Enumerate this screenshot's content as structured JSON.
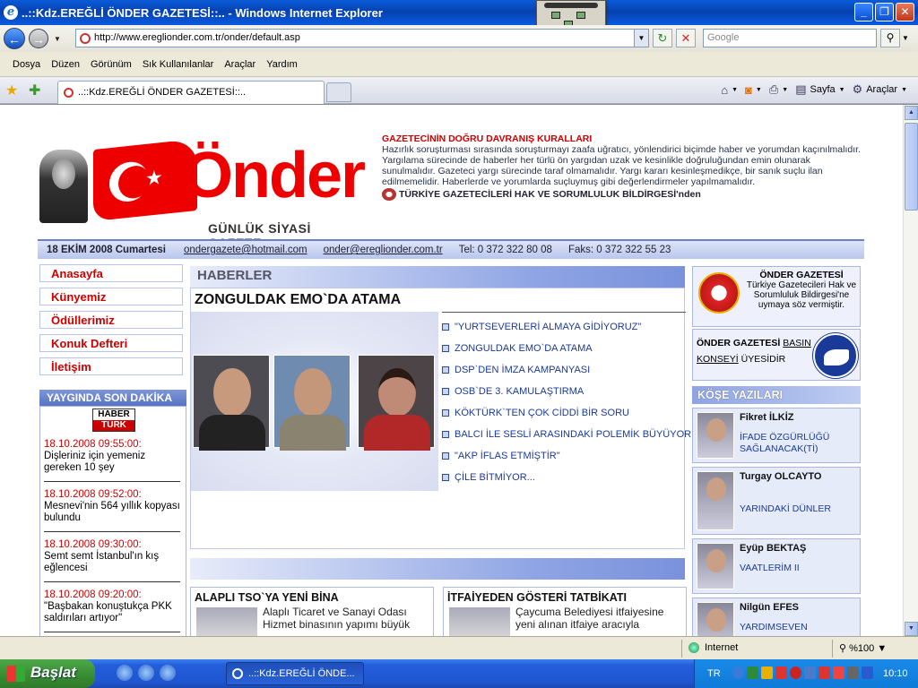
{
  "window": {
    "title": "..::Kdz.EREĞLİ ÖNDER GAZETESİ::.. - Windows Internet Explorer"
  },
  "address": {
    "url": "http://www.ereglionder.com.tr/onder/default.asp",
    "search_placeholder": "Google"
  },
  "menu": [
    "Dosya",
    "Düzen",
    "Görünüm",
    "Sık Kullanılanlar",
    "Araçlar",
    "Yardım"
  ],
  "tab": {
    "title": "..::Kdz.EREĞLİ ÖNDER GAZETESİ::.."
  },
  "commandbar": {
    "page": "Sayfa",
    "tools": "Araçlar"
  },
  "page": {
    "logo": {
      "word": "Önder",
      "subtitle": "GÜNLÜK SİYASİ GAZETE"
    },
    "rules": {
      "title": "GAZETECİNİN DOĞRU DAVRANIŞ KURALLARI",
      "body": "Hazırlık soruşturması sırasında soruşturmayı zaafa uğratıcı, yönlendirici biçimde haber ve yorumdan kaçınılmalıdır. Yargılama sürecinde de haberler her türlü ön yargıdan uzak ve kesinlikle doğruluğundan emin olunarak sunulmalıdır. Gazeteci yargı sürecinde taraf olmamalıdır. Yargı kararı kesinleşmedikçe, bir sanık suçlu ilan edilmemelidir. Haberlerde ve yorumlarda suçluymuş gibi değerlendirmeler yapılmamalıdır.",
      "source": "TÜRKİYE GAZETECİLERİ HAK VE SORUMLULUK BİLDİRGESİ'nden"
    },
    "datebar": {
      "date": "18 EKİM 2008 Cumartesi",
      "email1": "ondergazete@hotmail.com",
      "email2": "onder@ereglionder.com.tr",
      "tel": "Tel: 0 372 322 80 08",
      "fax": "Faks: 0 372 322 55 23"
    },
    "nav": [
      "Anasayfa",
      "Künyemiz",
      "Ödüllerimiz",
      "Konuk Defteri",
      "İletişim"
    ],
    "breaking": {
      "title": "YAYGINDA SON DAKİKA",
      "logo_top": "HABER",
      "logo_bottom": "TÜRK",
      "items": [
        {
          "time": "18.10.2008 09:55:00:",
          "text": "Dişleriniz için yemeniz gereken 10 şey"
        },
        {
          "time": "18.10.2008 09:52:00:",
          "text": "Mesnevi'nin 564 yıllık kopyası bulundu"
        },
        {
          "time": "18.10.2008 09:30:00:",
          "text": "Semt semt İstanbul'ın kış eğlencesi"
        },
        {
          "time": "18.10.2008 09:20:00:",
          "text": "\"Başbakan konuştukça PKK saldırıları artıyor\""
        }
      ]
    },
    "news": {
      "section": "HABERLER",
      "headline": "ZONGULDAK EMO`DA ATAMA",
      "links": [
        "\"YURTSEVERLERİ ALMAYA GİDİYORUZ\"",
        "ZONGULDAK EMO`DA ATAMA",
        "DSP`DEN İMZA KAMPANYASI",
        "OSB`DE 3. KAMULAŞTIRMA",
        "KÖKTÜRK`TEN ÇOK CİDDİ BİR SORU",
        "BALCI İLE SESLİ ARASINDAKİ POLEMİK BÜYÜYOR",
        "\"AKP İFLAS ETMİŞTİR\"",
        "ÇİLE BİTMİYOR..."
      ]
    },
    "subnews": [
      {
        "title": "ALAPLI TSO`YA YENİ BİNA",
        "text": "Alaplı Ticaret ve Sanayi Odası Hizmet binasının yapımı büyük"
      },
      {
        "title": "İTFAİYEDEN GÖSTERİ TATBİKATI",
        "text": "Çaycuma Belediyesi itfaiyesine yeni alınan itfaiye aracıyla"
      }
    ],
    "right": {
      "box1_title": "ÖNDER GAZETESİ",
      "box1_text": "Türkiye Gazetecileri Hak ve Sorumluluk Bildirgesi'ne uymaya söz vermiştir.",
      "box2_bold": "ÖNDER GAZETESİ",
      "box2_link": "BASIN KONSEYİ",
      "box2_rest": "ÜYESİDİR",
      "columns_title": "KÖŞE YAZILARI",
      "columnists": [
        {
          "name": "Fikret İLKİZ",
          "article": "İFADE ÖZGÜRLÜĞÜ SAĞLANACAK(Tİ)"
        },
        {
          "name": "Turgay OLCAYTO",
          "article": "YARINDAKİ DÜNLER"
        },
        {
          "name": "Eyüp BEKTAŞ",
          "article": "VAATLERİM II"
        },
        {
          "name": "Nilgün EFES",
          "article": "YARDIMSEVEN"
        }
      ]
    }
  },
  "status": {
    "zone": "Internet",
    "zoom": "%100"
  },
  "taskbar": {
    "start": "Başlat",
    "item": "..::Kdz.EREĞLİ ÖNDE...",
    "lang": "TR",
    "clock": "10:10"
  }
}
